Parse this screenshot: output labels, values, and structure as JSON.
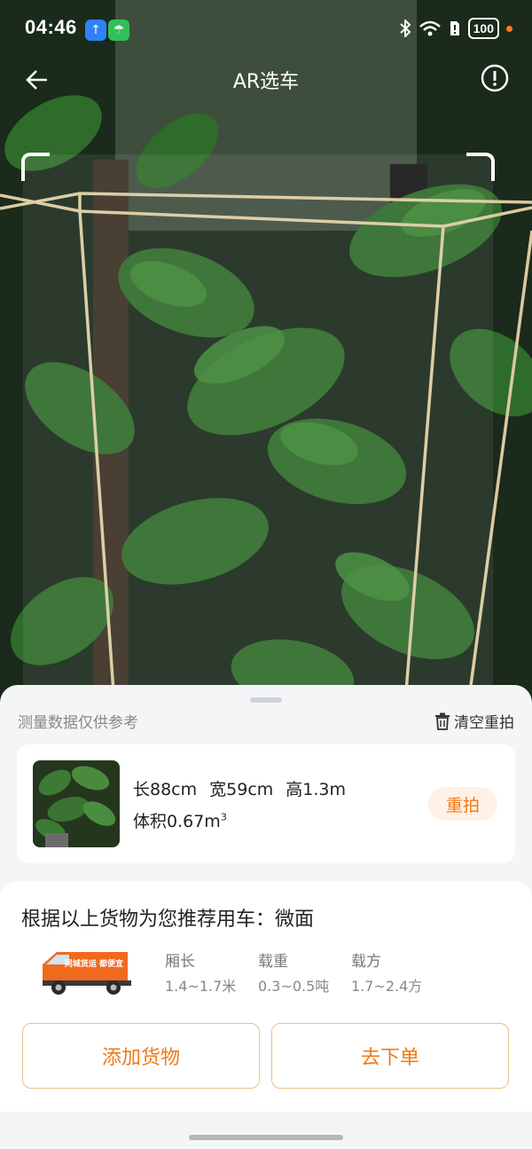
{
  "status_bar": {
    "time": "04:46",
    "battery": "100"
  },
  "header": {
    "title": "AR选车"
  },
  "sheet": {
    "note": "测量数据仅供参考",
    "clear_label": "清空重拍"
  },
  "cargo": {
    "length": "长88cm",
    "width": "宽59cm",
    "height": "高1.3m",
    "volume_prefix": "体积0.67m",
    "volume_sup": "3",
    "retake_label": "重拍"
  },
  "recommend": {
    "title": "根据以上货物为您推荐用车：微面",
    "vehicle_text": "同城货运 都便宜",
    "specs": [
      {
        "label": "厢长",
        "value": "1.4~1.7米"
      },
      {
        "label": "载重",
        "value": "0.3~0.5吨"
      },
      {
        "label": "载方",
        "value": "1.7~2.4方"
      }
    ],
    "add_cargo_label": "添加货物",
    "order_label": "去下单"
  },
  "colors": {
    "accent": "#ef7a16",
    "accent_bg": "#fff1e5",
    "ar_line": "#d9caa0"
  }
}
